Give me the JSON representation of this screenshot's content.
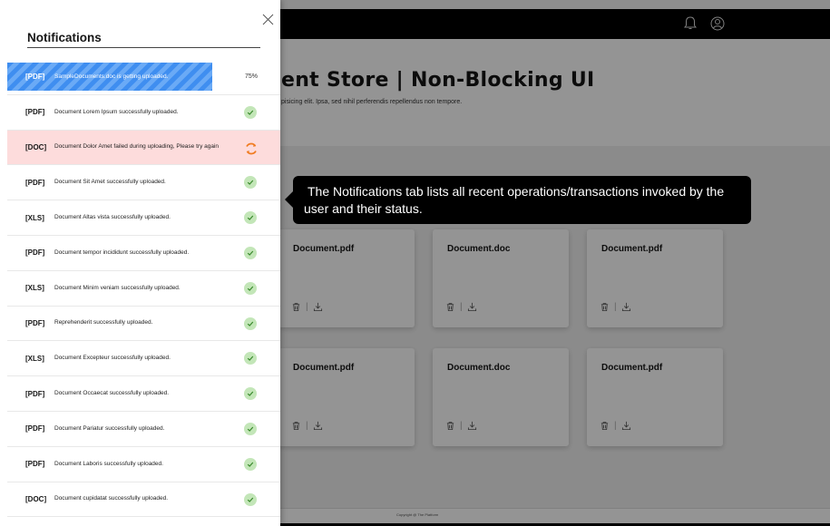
{
  "app": {
    "hero_title": "ent Store | Non-Blocking UI",
    "hero_subtitle": "pisicing elit. Ipsa, sed nihil perferendis repellendus non tempore.",
    "footer": "Copyright @ The Platform",
    "top_icons": [
      "bell-icon",
      "user-icon"
    ],
    "cards": [
      {
        "title": "Document.pdf"
      },
      {
        "title": "Document.doc"
      },
      {
        "title": "Document.pdf"
      },
      {
        "title": "Document.pdf"
      },
      {
        "title": "Document.doc"
      },
      {
        "title": "Document.pdf"
      }
    ],
    "card_separator": "|"
  },
  "tooltip": {
    "line1": "The Notifications tab lists all recent operations/transactions invoked by the",
    "line2": "user and their status."
  },
  "notifications": {
    "title": "Notifications",
    "colors": {
      "progress": "#3f8ef0",
      "failed_bg": "#fddcdc",
      "success_check": "#c3e6b8",
      "retry": "#f07c22"
    },
    "items": [
      {
        "tag": "[PDF]",
        "message": "SampleDocuments.doc is getting uploaded.",
        "status": "uploading",
        "progress_label": "75%",
        "progress": 0.75
      },
      {
        "tag": "[PDF]",
        "message": "Document Lorem Ipsum successfully uploaded.",
        "status": "success"
      },
      {
        "tag": "[DOC]",
        "message": "Document Dolor Amet failed during uploading, Please try again",
        "status": "failed"
      },
      {
        "tag": "[PDF]",
        "message": "Document Sit Amet successfully uploaded.",
        "status": "success"
      },
      {
        "tag": "[XLS]",
        "message": "Document Altas vista successfully uploaded.",
        "status": "success"
      },
      {
        "tag": "[PDF]",
        "message": "Document tempor incididunt successfully uploaded.",
        "status": "success"
      },
      {
        "tag": "[XLS]",
        "message": "Document Minim veniam successfully uploaded.",
        "status": "success"
      },
      {
        "tag": "[PDF]",
        "message": "Reprehenderit successfully uploaded.",
        "status": "success"
      },
      {
        "tag": "[XLS]",
        "message": "Document Excepteur successfully uploaded.",
        "status": "success"
      },
      {
        "tag": "[PDF]",
        "message": "Document Occaecat successfully uploaded.",
        "status": "success"
      },
      {
        "tag": "[PDF]",
        "message": "Document Pariatur successfully uploaded.",
        "status": "success"
      },
      {
        "tag": "[PDF]",
        "message": "Document Laboris successfully uploaded.",
        "status": "success"
      },
      {
        "tag": "[DOC]",
        "message": "Document cupidatat successfully uploaded.",
        "status": "success"
      }
    ]
  }
}
